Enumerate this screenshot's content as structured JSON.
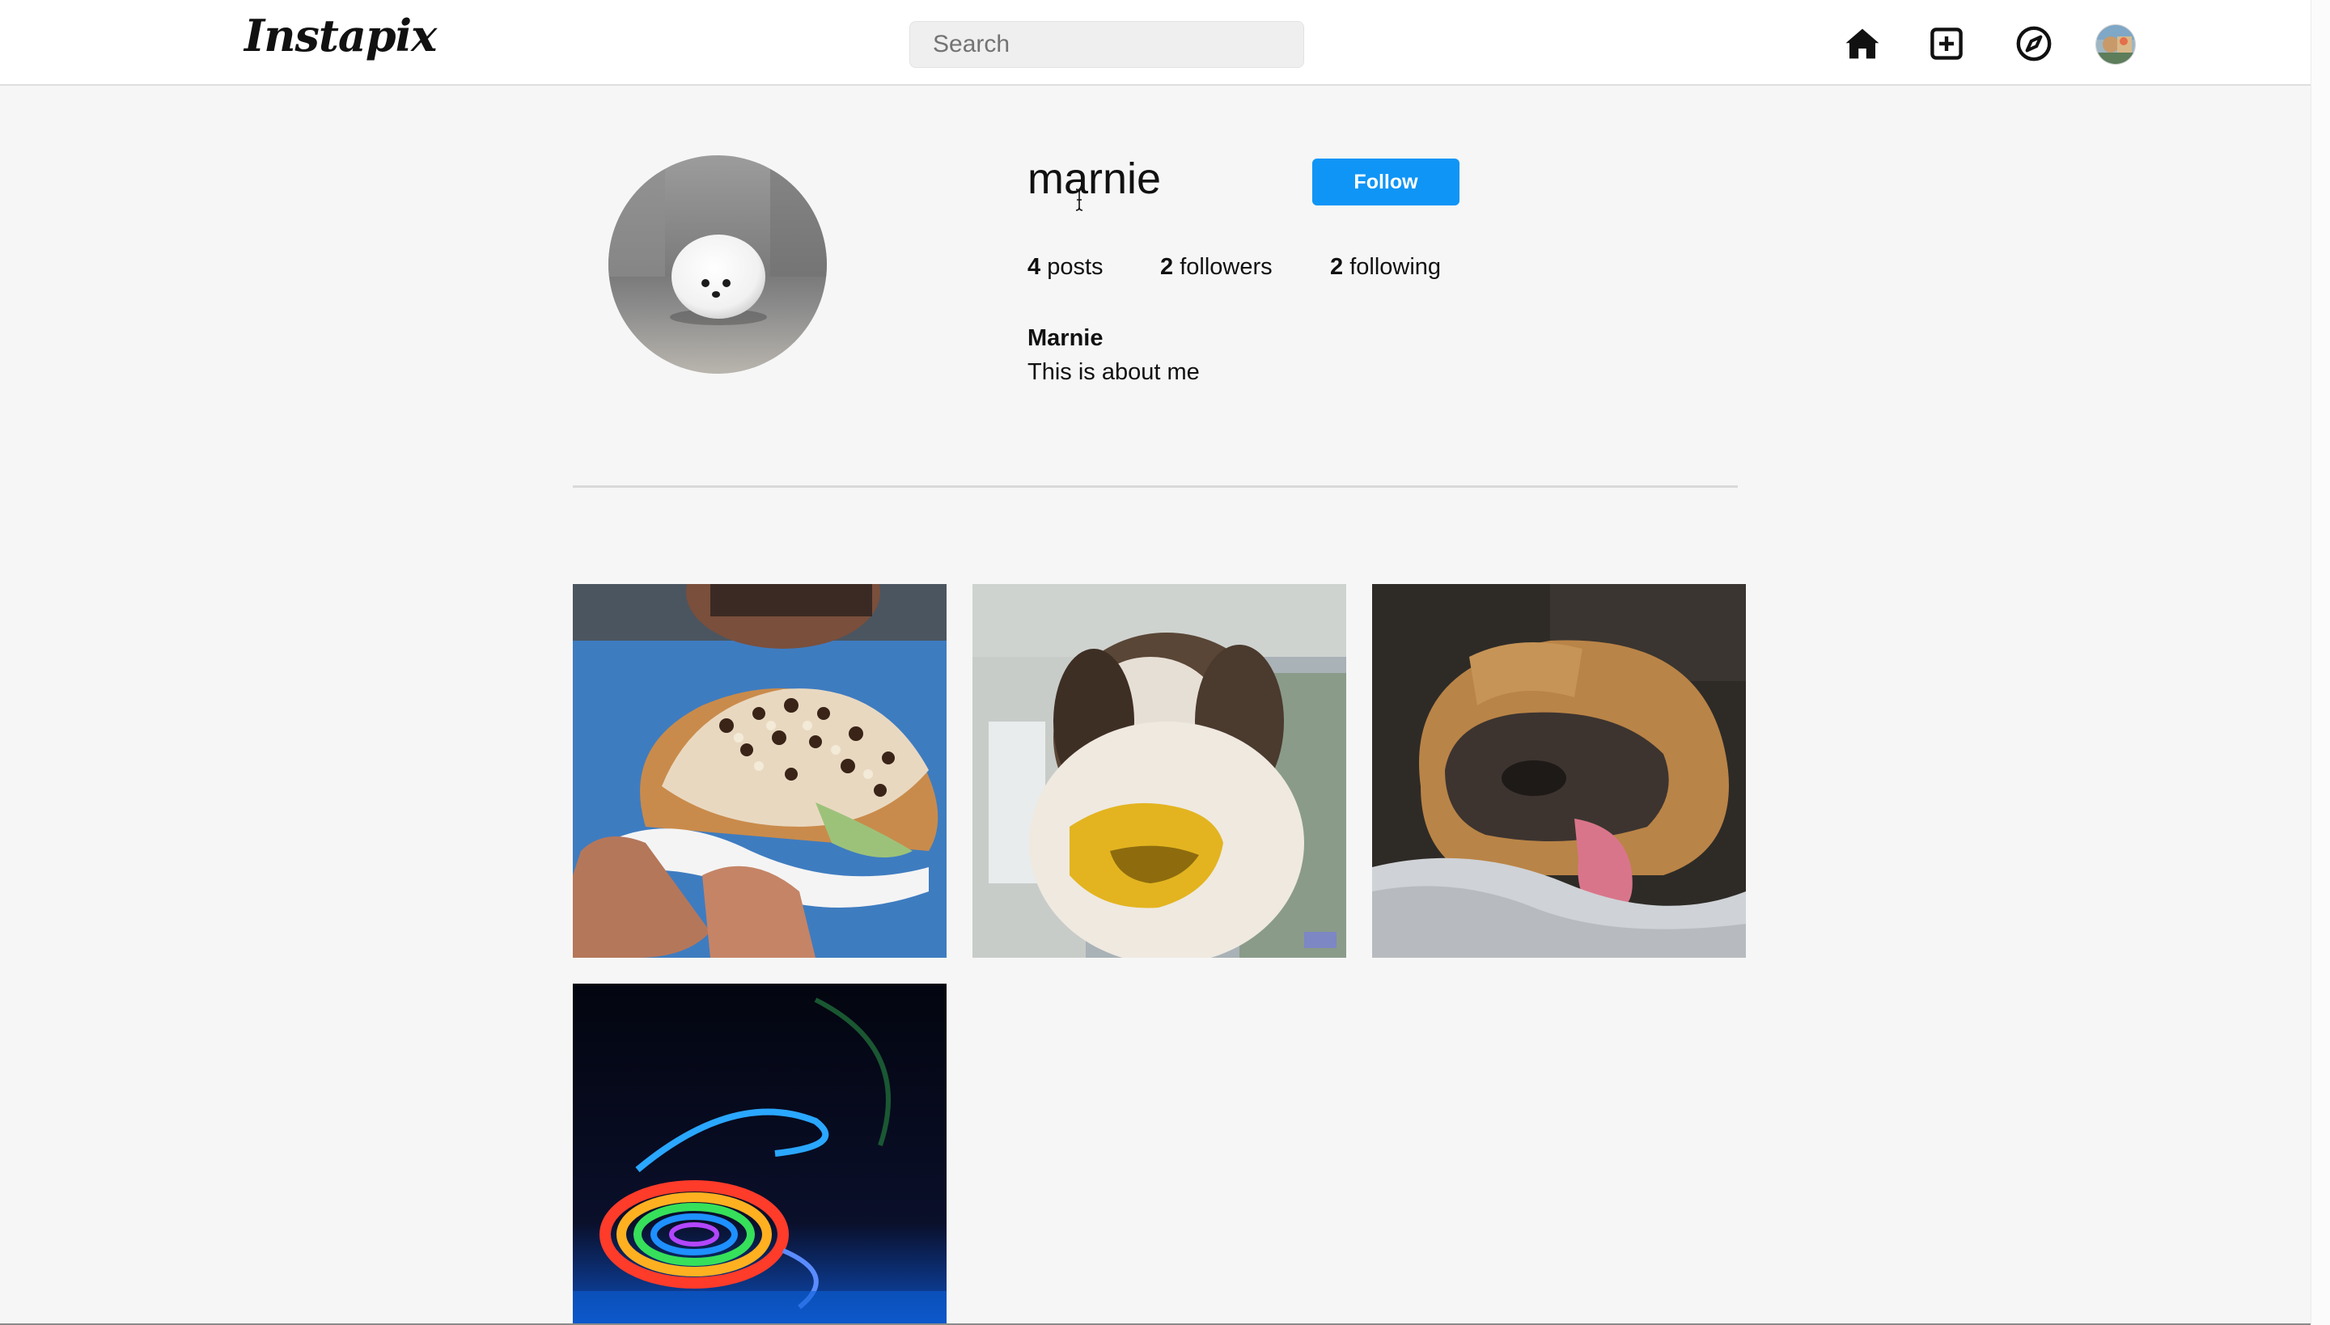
{
  "header": {
    "logo_text": "Instapix",
    "search_placeholder": "Search",
    "nav": {
      "home_icon": "home-icon",
      "add_icon": "add-post-icon",
      "explore_icon": "compass-icon",
      "avatar_icon": "user-avatar"
    }
  },
  "profile": {
    "username": "marnie",
    "follow_label": "Follow",
    "stats": {
      "posts_count": "4",
      "posts_label": " posts",
      "followers_count": "2",
      "followers_label": " followers",
      "following_count": "2",
      "following_label": " following"
    },
    "full_name": "Marnie",
    "bio": "This is about me"
  },
  "posts": [
    {
      "subject": "ice cream taco covered in nuts and chocolate"
    },
    {
      "subject": "dog wearing yellow duck-bill muzzle"
    },
    {
      "subject": "sleeping pug with tongue out"
    },
    {
      "subject": "colorful abstract light swirl"
    }
  ],
  "colors": {
    "follow_button": "#0f95f6",
    "background": "#f6f6f6"
  }
}
